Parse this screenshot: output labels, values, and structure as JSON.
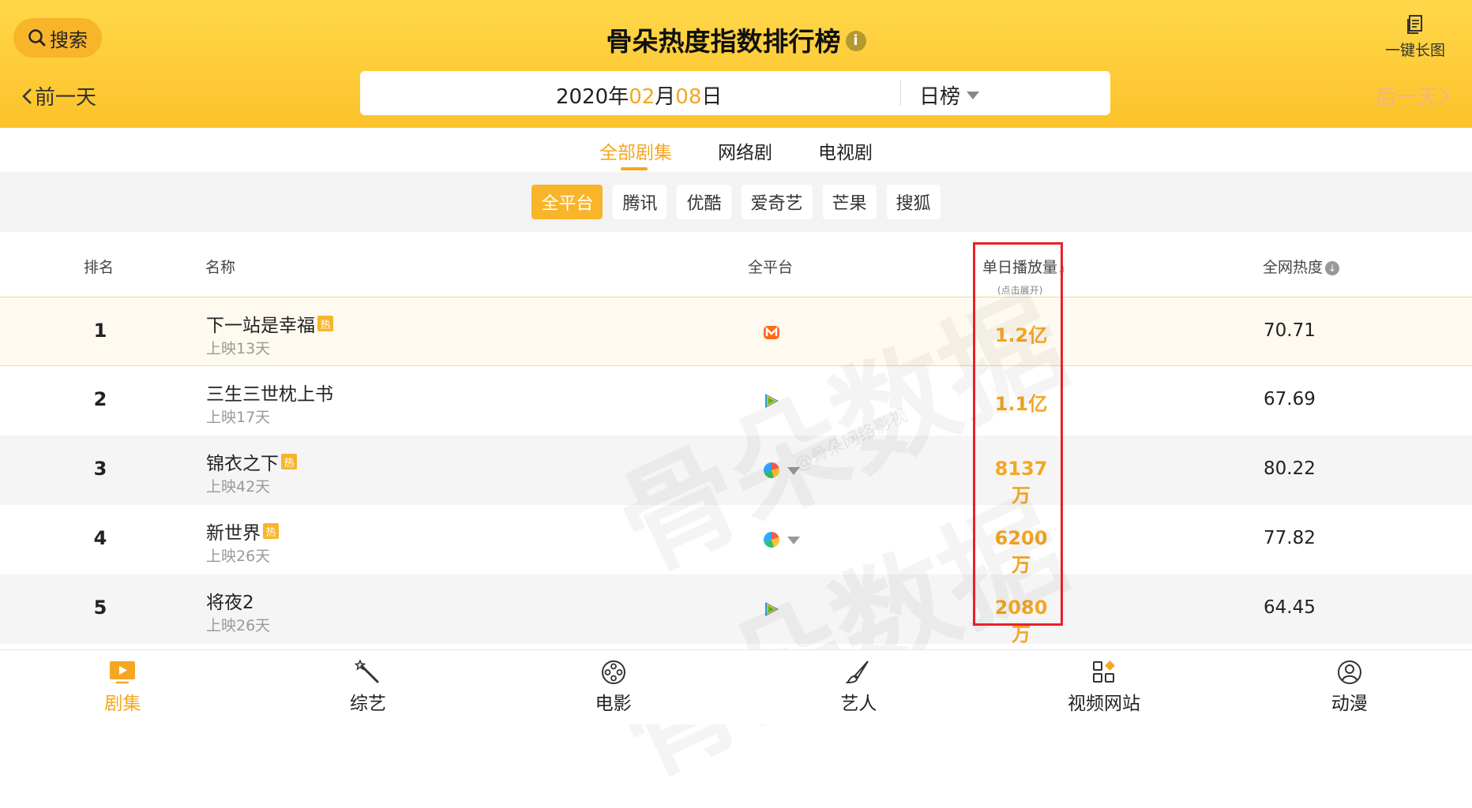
{
  "header": {
    "search_label": "搜索",
    "title": "骨朵热度指数排行榜",
    "info_icon": "i",
    "long_image_label": "一键长图",
    "prev_day": "前一天",
    "next_day": "后一天",
    "date": {
      "year": "2020",
      "year_unit": "年",
      "month": "02",
      "month_unit": "月",
      "day": "08",
      "day_unit": "日"
    },
    "period_label": "日榜",
    "colors": {
      "bg": "#fcc22a",
      "accent": "#f5a623"
    }
  },
  "tabs": [
    {
      "label": "全部剧集",
      "active": true
    },
    {
      "label": "网络剧",
      "active": false
    },
    {
      "label": "电视剧",
      "active": false
    }
  ],
  "platforms": [
    {
      "label": "全平台",
      "active": true
    },
    {
      "label": "腾讯",
      "active": false
    },
    {
      "label": "优酷",
      "active": false
    },
    {
      "label": "爱奇艺",
      "active": false
    },
    {
      "label": "芒果",
      "active": false
    },
    {
      "label": "搜狐",
      "active": false
    }
  ],
  "table": {
    "headers": {
      "rank": "排名",
      "name": "名称",
      "platform": "全平台",
      "daily_plays": "单日播放量",
      "daily_plays_sub": "(点击展开)",
      "heat": "全网热度"
    },
    "hot_badge": "热",
    "rows": [
      {
        "rank": "1",
        "name": "下一站是幸福",
        "hot": true,
        "days": "上映13天",
        "platform_icon": "mango-icon",
        "plays": "1.2亿",
        "heat": "70.71"
      },
      {
        "rank": "2",
        "name": "三生三世枕上书",
        "hot": false,
        "days": "上映17天",
        "platform_icon": "tencent-video-icon",
        "plays": "1.1亿",
        "heat": "67.69"
      },
      {
        "rank": "3",
        "name": "锦衣之下",
        "hot": true,
        "days": "上映42天",
        "platform_icon": "multi-platform-icon",
        "plays": "8137万",
        "heat": "80.22"
      },
      {
        "rank": "4",
        "name": "新世界",
        "hot": true,
        "days": "上映26天",
        "platform_icon": "multi-platform-icon",
        "plays": "6200万",
        "heat": "77.82"
      },
      {
        "rank": "5",
        "name": "将夜2",
        "hot": false,
        "days": "上映26天",
        "platform_icon": "tencent-video-icon",
        "plays": "2080万",
        "heat": "64.45"
      }
    ]
  },
  "watermark": {
    "text": "骨朵数据",
    "sub": "@骨朵网络影视"
  },
  "bottom_nav": [
    {
      "label": "剧集",
      "icon": "tv-icon",
      "active": true
    },
    {
      "label": "综艺",
      "icon": "magic-wand-icon",
      "active": false
    },
    {
      "label": "电影",
      "icon": "film-reel-icon",
      "active": false
    },
    {
      "label": "艺人",
      "icon": "brush-icon",
      "active": false
    },
    {
      "label": "视频网站",
      "icon": "apps-icon",
      "active": false
    },
    {
      "label": "动漫",
      "icon": "user-circle-icon",
      "active": false
    }
  ]
}
